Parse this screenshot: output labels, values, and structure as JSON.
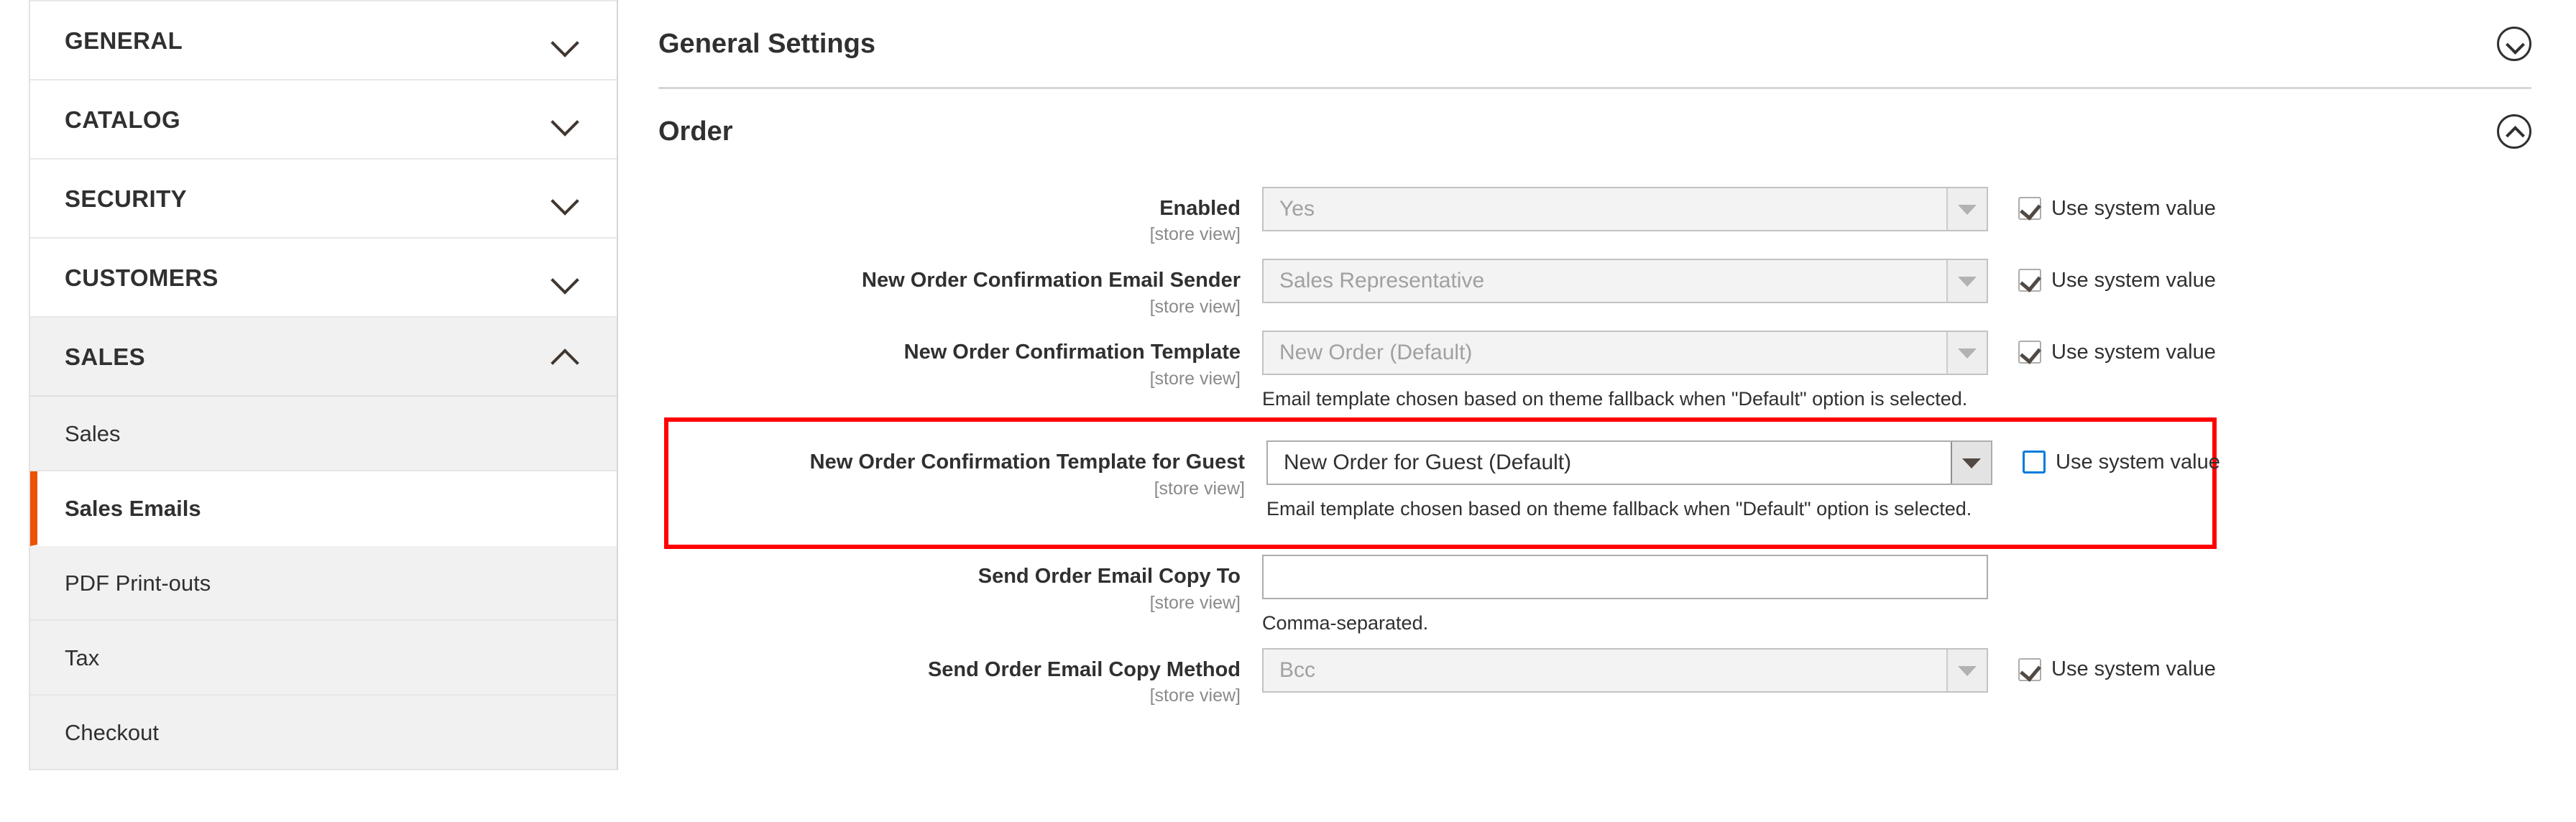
{
  "sidebar": {
    "sections": [
      {
        "label": "GENERAL",
        "icon": "chevron-down-icon",
        "expanded": false
      },
      {
        "label": "CATALOG",
        "icon": "chevron-down-icon",
        "expanded": false
      },
      {
        "label": "SECURITY",
        "icon": "chevron-down-icon",
        "expanded": false
      },
      {
        "label": "CUSTOMERS",
        "icon": "chevron-down-icon",
        "expanded": false
      },
      {
        "label": "SALES",
        "icon": "chevron-up-icon",
        "expanded": true
      }
    ],
    "sales_items": [
      {
        "label": "Sales",
        "current": false
      },
      {
        "label": "Sales Emails",
        "current": true
      },
      {
        "label": "PDF Print-outs",
        "current": false
      },
      {
        "label": "Tax",
        "current": false
      },
      {
        "label": "Checkout",
        "current": false
      }
    ]
  },
  "main": {
    "sections": [
      {
        "title": "General Settings",
        "toggle_icon": "chevron-down-circle-icon",
        "expanded": false
      },
      {
        "title": "Order",
        "toggle_icon": "chevron-up-circle-icon",
        "expanded": true
      }
    ],
    "scope_text": "[store view]",
    "system_value_label": "Use system value",
    "rows": [
      {
        "label": "Enabled",
        "control": "select",
        "value": "Yes",
        "disabled": true,
        "hint": "",
        "system_value_checked": true,
        "highlighted": false
      },
      {
        "label": "New Order Confirmation Email Sender",
        "control": "select",
        "value": "Sales Representative",
        "disabled": true,
        "hint": "",
        "system_value_checked": true,
        "highlighted": false
      },
      {
        "label": "New Order Confirmation Template",
        "control": "select",
        "value": "New Order (Default)",
        "disabled": true,
        "hint": "Email template chosen based on theme fallback when \"Default\" option is selected.",
        "system_value_checked": true,
        "highlighted": false
      },
      {
        "label": "New Order Confirmation Template for Guest",
        "control": "select",
        "value": "New Order for Guest (Default)",
        "disabled": false,
        "hint": "Email template chosen based on theme fallback when \"Default\" option is selected.",
        "system_value_checked": false,
        "system_value_focused": true,
        "highlighted": true
      },
      {
        "label": "Send Order Email Copy To",
        "control": "text",
        "value": "",
        "placeholder": "",
        "disabled": false,
        "hint": "Comma-separated.",
        "system_value_checked": null,
        "highlighted": false
      },
      {
        "label": "Send Order Email Copy Method",
        "control": "select",
        "value": "Bcc",
        "disabled": true,
        "hint": "",
        "system_value_checked": true,
        "highlighted": false
      }
    ]
  },
  "colors": {
    "accent_orange": "#eb5202",
    "highlight_red": "#ff0000",
    "focus_blue": "#007bdb",
    "text_dark": "#303030",
    "text_muted": "#8a8a8a"
  }
}
